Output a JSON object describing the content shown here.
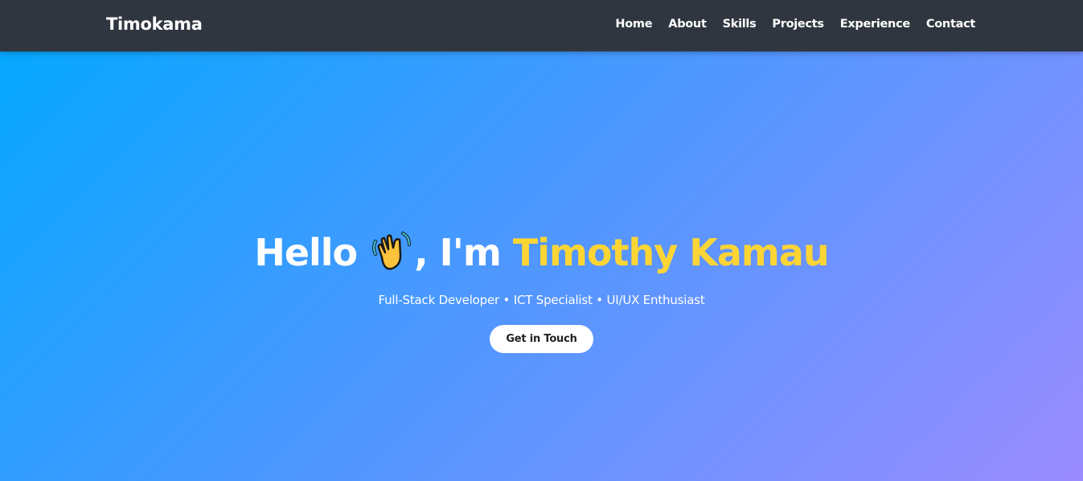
{
  "nav": {
    "logo": "Timokama",
    "links": [
      "Home",
      "About",
      "Skills",
      "Projects",
      "Experience",
      "Contact"
    ]
  },
  "hero": {
    "greeting": "Hello",
    "emoji": "waving-hand-icon",
    "intro": ", I'm",
    "name": "Timothy Kamau",
    "subtitle": "Full-Stack Developer • ICT Specialist • UI/UX Enthusiast",
    "cta": "Get in Touch"
  },
  "colors": {
    "nav_bg": "#303640",
    "accent": "#fcd535",
    "gradient_start": "#00a8ff",
    "gradient_end": "#9b8cff"
  }
}
